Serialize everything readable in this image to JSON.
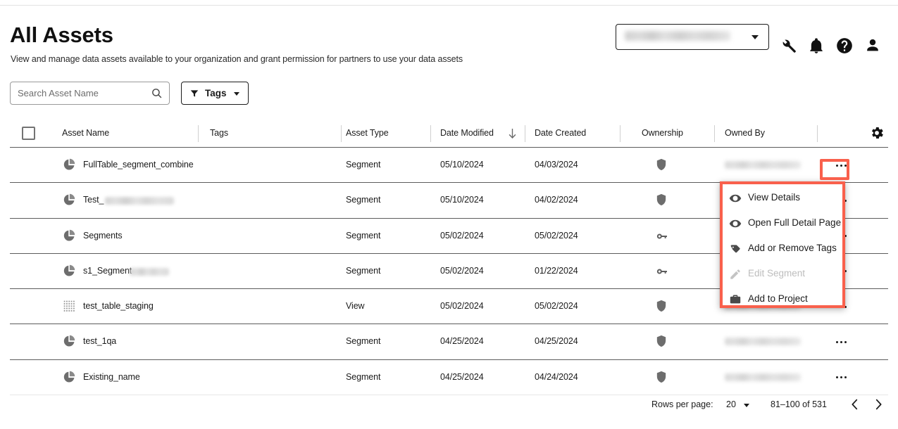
{
  "header": {
    "title": "All Assets",
    "subtitle": "View and manage data assets available to your organization and grant permission for partners to use your data assets",
    "env_selector": {
      "value": "",
      "redacted": true
    },
    "icons": [
      "wrench-icon",
      "bell-icon",
      "help-icon",
      "user-icon"
    ]
  },
  "toolbar": {
    "search_placeholder": "Search Asset Name",
    "search_value": "",
    "tags_label": "Tags"
  },
  "table": {
    "columns": [
      {
        "key": "select",
        "label": ""
      },
      {
        "key": "name",
        "label": "Asset Name"
      },
      {
        "key": "tags",
        "label": "Tags"
      },
      {
        "key": "type",
        "label": "Asset Type"
      },
      {
        "key": "modified",
        "label": "Date Modified"
      },
      {
        "key": "created",
        "label": "Date Created"
      },
      {
        "key": "ownership",
        "label": "Ownership"
      },
      {
        "key": "ownedby",
        "label": "Owned By"
      }
    ],
    "sort": {
      "column": "Date Modified",
      "direction": "desc",
      "icon": "arrow-down-icon"
    },
    "settings_icon": "gear-icon",
    "rows": [
      {
        "name": "FullTable_segment_combine",
        "name_redacted": false,
        "name_redacted_width": 0,
        "tags": "",
        "type": "Segment",
        "modified": "05/10/2024",
        "created": "04/03/2024",
        "ownership_icon": "shield-icon",
        "owned_by": "",
        "owned_by_redacted": true,
        "asset_icon": "segment-icon"
      },
      {
        "name": "Test_",
        "name_redacted": true,
        "name_redacted_width": 98,
        "tags": "",
        "type": "Segment",
        "modified": "05/10/2024",
        "created": "04/02/2024",
        "ownership_icon": "shield-icon",
        "owned_by": "",
        "owned_by_redacted": true,
        "asset_icon": "segment-icon"
      },
      {
        "name": "Segments",
        "name_redacted": false,
        "name_redacted_width": 0,
        "tags": "",
        "type": "Segment",
        "modified": "05/02/2024",
        "created": "05/02/2024",
        "ownership_icon": "key-icon",
        "owned_by": "",
        "owned_by_redacted": true,
        "asset_icon": "segment-icon"
      },
      {
        "name": "s1_Segment",
        "name_redacted": true,
        "name_redacted_width": 56,
        "tags": "",
        "type": "Segment",
        "modified": "05/02/2024",
        "created": "01/22/2024",
        "ownership_icon": "key-icon",
        "owned_by": "",
        "owned_by_redacted": true,
        "asset_icon": "segment-icon"
      },
      {
        "name": "test_table_staging",
        "name_redacted": false,
        "name_redacted_width": 0,
        "tags": "",
        "type": "View",
        "modified": "05/02/2024",
        "created": "05/02/2024",
        "ownership_icon": "shield-icon",
        "owned_by": "",
        "owned_by_redacted": true,
        "asset_icon": "table-icon"
      },
      {
        "name": "test_1qa",
        "name_redacted": false,
        "name_redacted_width": 0,
        "tags": "",
        "type": "Segment",
        "modified": "04/25/2024",
        "created": "04/25/2024",
        "ownership_icon": "shield-icon",
        "owned_by": "",
        "owned_by_redacted": true,
        "asset_icon": "segment-icon"
      },
      {
        "name": "Existing_name",
        "name_redacted": false,
        "name_redacted_width": 0,
        "tags": "",
        "type": "Segment",
        "modified": "04/25/2024",
        "created": "04/24/2024",
        "ownership_icon": "shield-icon",
        "owned_by": "",
        "owned_by_redacted": true,
        "asset_icon": "segment-icon"
      }
    ]
  },
  "context_menu": {
    "open_for_row": 0,
    "highlight_color": "#f9604c",
    "items": [
      {
        "label": "View Details",
        "icon": "eye-icon",
        "disabled": false
      },
      {
        "label": "Open Full Detail Page",
        "icon": "eye-icon",
        "disabled": false
      },
      {
        "label": "Add or Remove Tags",
        "icon": "tag-icon",
        "disabled": false
      },
      {
        "label": "Edit Segment",
        "icon": "pencil-icon",
        "disabled": true
      },
      {
        "label": "Add to Project",
        "icon": "briefcase-icon",
        "disabled": false
      }
    ]
  },
  "pagination": {
    "rows_per_page_label": "Rows per page:",
    "rows_per_page_value": "20",
    "range": "81–100 of 531",
    "prev_icon": "chevron-left-icon",
    "next_icon": "chevron-right-icon"
  }
}
